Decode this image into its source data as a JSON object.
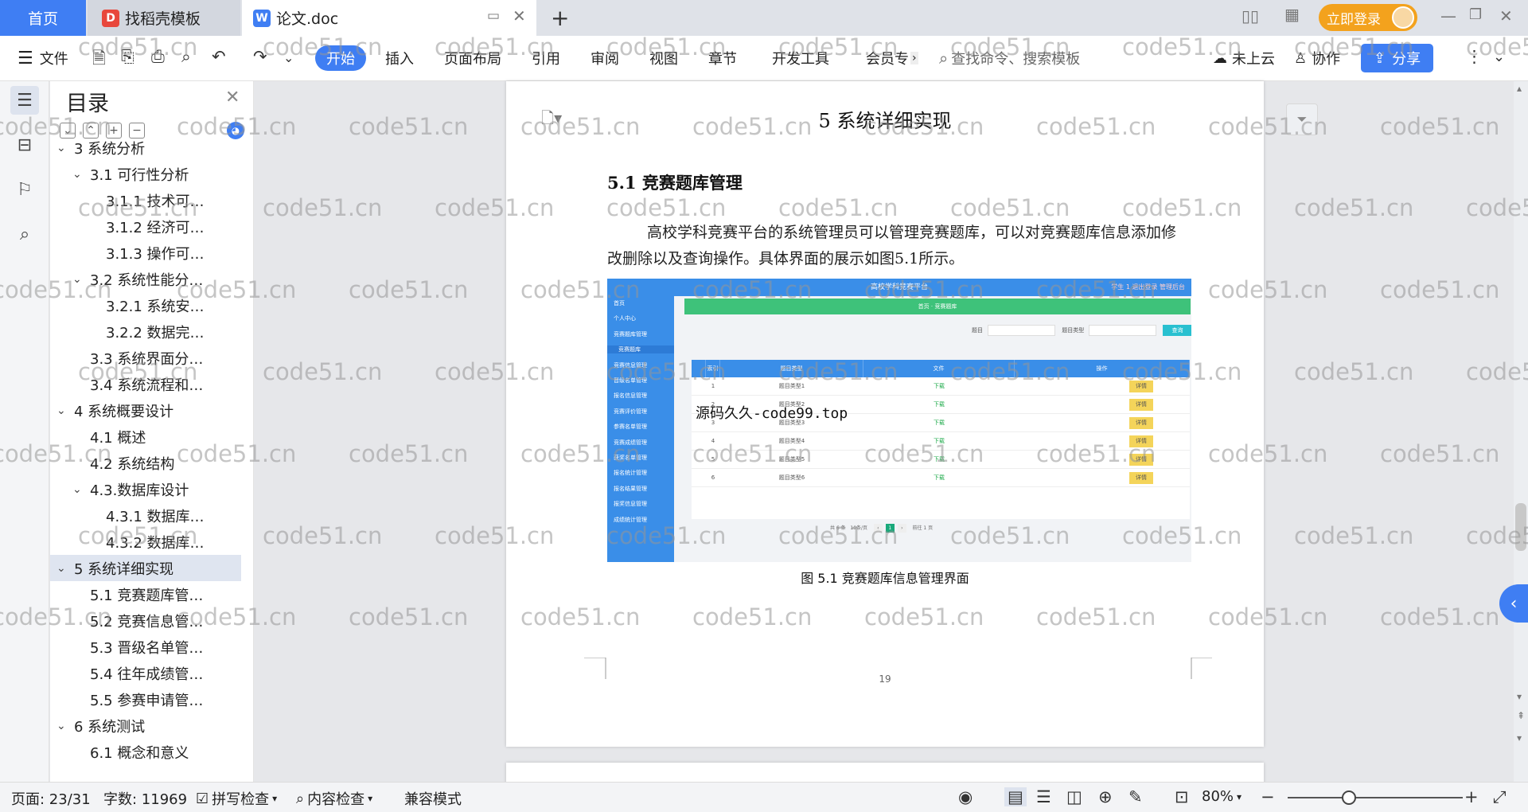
{
  "tabs": {
    "home": "首页",
    "template": "找稻壳模板",
    "doc": "论文.doc"
  },
  "topbar": {
    "login": "立即登录"
  },
  "toolbar": {
    "file": "文件",
    "start": "开始",
    "insert": "插入",
    "layout": "页面布局",
    "reference": "引用",
    "review": "审阅",
    "view": "视图",
    "chapter": "章节",
    "devtools": "开发工具",
    "member": "会员专",
    "search_placeholder": "查找命令、搜索模板",
    "cloud": "未上云",
    "collab": "协作",
    "share": "分享"
  },
  "toc": {
    "title": "目录",
    "items": [
      {
        "label": "3 系统分析",
        "level": 0,
        "chev": "v"
      },
      {
        "label": "3.1 可行性分析",
        "level": 1,
        "chev": "v"
      },
      {
        "label": "3.1.1 技术可…",
        "level": 2,
        "chev": ""
      },
      {
        "label": "3.1.2 经济可…",
        "level": 2,
        "chev": ""
      },
      {
        "label": "3.1.3 操作可…",
        "level": 2,
        "chev": ""
      },
      {
        "label": "3.2 系统性能分…",
        "level": 1,
        "chev": "v"
      },
      {
        "label": "3.2.1  系统安…",
        "level": 2,
        "chev": ""
      },
      {
        "label": "3.2.2  数据完…",
        "level": 2,
        "chev": ""
      },
      {
        "label": "3.3 系统界面分…",
        "level": 1,
        "chev": ""
      },
      {
        "label": "3.4 系统流程和…",
        "level": 1,
        "chev": ""
      },
      {
        "label": "4 系统概要设计",
        "level": 0,
        "chev": "v"
      },
      {
        "label": "4.1 概述",
        "level": 1,
        "chev": ""
      },
      {
        "label": "4.2 系统结构",
        "level": 1,
        "chev": ""
      },
      {
        "label": "4.3.数据库设计",
        "level": 1,
        "chev": "v"
      },
      {
        "label": "4.3.1 数据库…",
        "level": 2,
        "chev": ""
      },
      {
        "label": "4.3.2 数据库…",
        "level": 2,
        "chev": ""
      },
      {
        "label": "5 系统详细实现",
        "level": 0,
        "chev": "v",
        "active": true
      },
      {
        "label": "5.1  竞赛题库管…",
        "level": 1,
        "chev": ""
      },
      {
        "label": "5.2  竞赛信息管…",
        "level": 1,
        "chev": ""
      },
      {
        "label": "5.3  晋级名单管…",
        "level": 1,
        "chev": ""
      },
      {
        "label": "5.4  往年成绩管…",
        "level": 1,
        "chev": ""
      },
      {
        "label": "5.5  参赛申请管…",
        "level": 1,
        "chev": ""
      },
      {
        "label": "6 系统测试",
        "level": 0,
        "chev": "v"
      },
      {
        "label": "6.1 概念和意义",
        "level": 1,
        "chev": ""
      }
    ]
  },
  "document": {
    "chapter_title": "5 系统详细实现",
    "section_title": "5.1  竞赛题库管理",
    "paragraph": "高校学科竞赛平台的系统管理员可以管理竞赛题库，可以对竞赛题库信息添加修改删除以及查询操作。具体界面的展示如图5.1所示。",
    "figure": {
      "app_title": "高校学科竞赛平台",
      "top_right": "学生 1   退出登录   管理后台",
      "sidebar": [
        "首页",
        "个人中心",
        "竞赛题库管理",
        "竞赛题库",
        "竞赛信息管理",
        "晋级名单管理",
        "报名信息管理",
        "竞赛评价管理",
        "参赛名单管理",
        "竞赛成绩管理",
        "获奖名单管理",
        "报名统计管理",
        "报名结果管理",
        "报奖信息管理",
        "成绩统计管理"
      ],
      "banner": "首页 · 竞赛题库",
      "search_label1": "题目",
      "search_label2": "题目类型",
      "search_btn": "查询",
      "columns": [
        "",
        "索引",
        "题目类型",
        "文件",
        "操作"
      ],
      "rows": [
        {
          "idx": "1",
          "type": "题目类型1",
          "file": "下载",
          "op": "详情"
        },
        {
          "idx": "2",
          "type": "题目类型2",
          "file": "下载",
          "op": "详情"
        },
        {
          "idx": "3",
          "type": "题目类型3",
          "file": "下载",
          "op": "详情"
        },
        {
          "idx": "4",
          "type": "题目类型4",
          "file": "下载",
          "op": "详情"
        },
        {
          "idx": "5",
          "type": "题目类型5",
          "file": "下载",
          "op": "详情"
        },
        {
          "idx": "6",
          "type": "题目类型6",
          "file": "下载",
          "op": "详情"
        }
      ],
      "pager_total": "共 6 条",
      "pager_size": "10条/页",
      "pager_current": "1",
      "pager_goto": "前往  1  页",
      "overlay_text": "源码久久-code99.top"
    },
    "caption": "图 5.1  竞赛题库信息管理界面",
    "page_number": "19"
  },
  "status": {
    "page": "页面: 23/31",
    "words": "字数: 11969",
    "spell": "拼写检查",
    "content": "内容检查",
    "compat": "兼容模式",
    "zoom": "80%"
  },
  "watermark": "code51.cn",
  "colors": {
    "accent": "#3f7ef3",
    "login": "#f3a21d"
  }
}
